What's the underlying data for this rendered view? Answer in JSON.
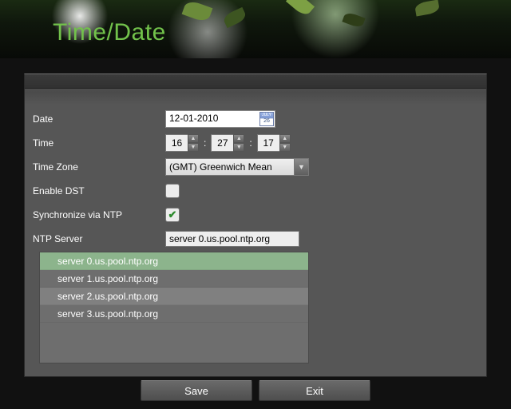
{
  "title": "Time/Date",
  "labels": {
    "date": "Date",
    "time": "Time",
    "tz": "Time Zone",
    "dst": "Enable DST",
    "ntp": "Synchronize via NTP",
    "ntp_server": "NTP Server"
  },
  "date": {
    "value": "12-01-2010",
    "icon_month": "JULY",
    "icon_day": "26"
  },
  "time": {
    "h": "16",
    "m": "27",
    "s": "17"
  },
  "timezone": {
    "selected": "(GMT) Greenwich Mean"
  },
  "dst_enabled": false,
  "ntp_enabled": true,
  "ntp_server_value": "server 0.us.pool.ntp.org",
  "ntp_servers": [
    {
      "label": "server 0.us.pool.ntp.org",
      "state": "sel"
    },
    {
      "label": "server 1.us.pool.ntp.org",
      "state": ""
    },
    {
      "label": "server 2.us.pool.ntp.org",
      "state": "hov"
    },
    {
      "label": "server 3.us.pool.ntp.org",
      "state": ""
    }
  ],
  "buttons": {
    "save": "Save",
    "exit": "Exit"
  }
}
